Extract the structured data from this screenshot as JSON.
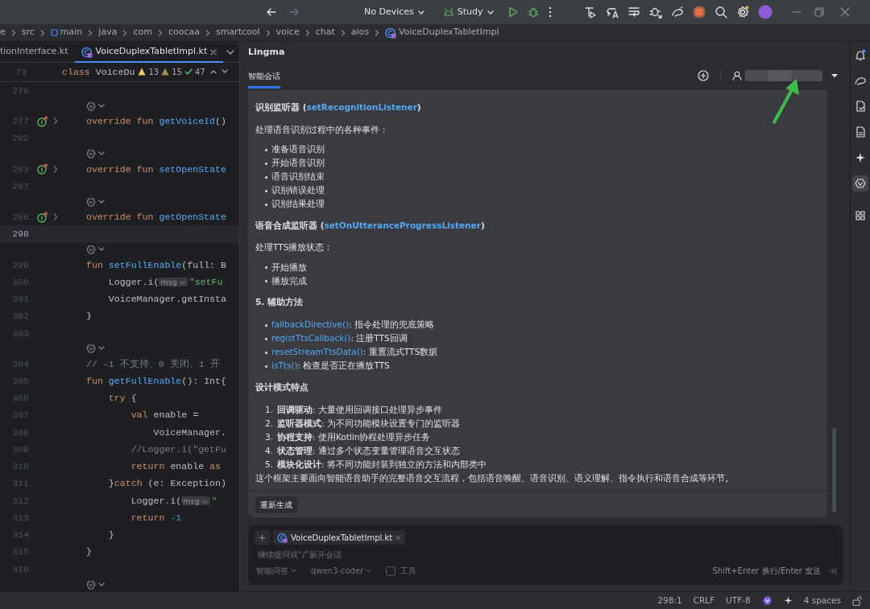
{
  "toolbar": {
    "device": "No Devices",
    "config": "Study"
  },
  "breadcrumb": [
    {
      "label": "e",
      "kind": "folder"
    },
    {
      "label": "src",
      "kind": "folder"
    },
    {
      "label": "main",
      "kind": "module"
    },
    {
      "label": "java",
      "kind": "folder"
    },
    {
      "label": "com",
      "kind": "folder"
    },
    {
      "label": "coocaa",
      "kind": "folder"
    },
    {
      "label": "smartcool",
      "kind": "folder"
    },
    {
      "label": "voice",
      "kind": "folder"
    },
    {
      "label": "chat",
      "kind": "folder"
    },
    {
      "label": "aios",
      "kind": "folder"
    },
    {
      "label": "VoiceDuplexTabletImpl",
      "kind": "class"
    }
  ],
  "editor_tabs": [
    {
      "label": "tionInterface.kt",
      "selected": false
    },
    {
      "label": "VoiceDuplexTabletImpl.kt",
      "selected": true
    }
  ],
  "sticky_line": {
    "number": "73",
    "tokens": [
      {
        "kind": "kw",
        "text": "class "
      },
      {
        "kind": "pl",
        "text": "VoiceDu"
      }
    ]
  },
  "inspections": [
    {
      "kind": "warning",
      "count": "13"
    },
    {
      "kind": "weak",
      "count": "15"
    },
    {
      "kind": "typo",
      "count": "47"
    }
  ],
  "code_lines": [
    {
      "kind": "code",
      "number": "276",
      "current": false,
      "implements": false
    },
    {
      "kind": "lens"
    },
    {
      "kind": "code",
      "number": "277",
      "current": false,
      "implements": true,
      "tokens": [
        {
          "kind": "kw",
          "text": "override fun "
        },
        {
          "kind": "fn",
          "text": "getVoiceId"
        },
        {
          "kind": "pl",
          "text": "()"
        }
      ]
    },
    {
      "kind": "code",
      "number": "282",
      "current": false,
      "implements": false
    },
    {
      "kind": "lens"
    },
    {
      "kind": "code",
      "number": "283",
      "current": false,
      "implements": true,
      "tokens": [
        {
          "kind": "kw",
          "text": "override fun "
        },
        {
          "kind": "fn",
          "text": "setOpenState"
        }
      ]
    },
    {
      "kind": "code",
      "number": "287",
      "current": false,
      "implements": false
    },
    {
      "kind": "lens"
    },
    {
      "kind": "code",
      "number": "288",
      "current": false,
      "implements": true,
      "tokens": [
        {
          "kind": "kw",
          "text": "override fun "
        },
        {
          "kind": "fn",
          "text": "getOpenState"
        }
      ]
    },
    {
      "kind": "code",
      "number": "298",
      "current": true,
      "implements": false
    },
    {
      "kind": "lens"
    },
    {
      "kind": "code",
      "number": "299",
      "current": false,
      "implements": false,
      "tokens": [
        {
          "kind": "kw",
          "text": "fun "
        },
        {
          "kind": "fn",
          "text": "setFullEnable"
        },
        {
          "kind": "pl",
          "text": "(full: B"
        }
      ]
    },
    {
      "kind": "code",
      "number": "300",
      "current": false,
      "implements": false,
      "tokens": [
        {
          "kind": "pl",
          "text": "    Logger.i("
        },
        {
          "kind": "hint",
          "text": "msg ="
        },
        {
          "kind": "str",
          "text": "\"setFu"
        }
      ]
    },
    {
      "kind": "code",
      "number": "301",
      "current": false,
      "implements": false,
      "tokens": [
        {
          "kind": "pl",
          "text": "    VoiceManager.getInsta"
        }
      ]
    },
    {
      "kind": "code",
      "number": "302",
      "current": false,
      "implements": false,
      "tokens": [
        {
          "kind": "pl",
          "text": "}"
        }
      ]
    },
    {
      "kind": "code",
      "number": "303",
      "current": false,
      "implements": false
    },
    {
      "kind": "lens"
    },
    {
      "kind": "code",
      "number": "304",
      "current": false,
      "implements": false,
      "tokens": [
        {
          "kind": "cm",
          "text": "// -1 不支持、0 关闭、1 开"
        }
      ]
    },
    {
      "kind": "code",
      "number": "305",
      "current": false,
      "implements": false,
      "tokens": [
        {
          "kind": "kw",
          "text": "fun "
        },
        {
          "kind": "fn",
          "text": "getFullEnable"
        },
        {
          "kind": "pl",
          "text": "(): Int{"
        }
      ]
    },
    {
      "kind": "code",
      "number": "306",
      "current": false,
      "implements": false,
      "tokens": [
        {
          "kind": "kw",
          "text": "    try "
        },
        {
          "kind": "pl",
          "text": "{"
        }
      ]
    },
    {
      "kind": "code",
      "number": "307",
      "current": false,
      "implements": false,
      "tokens": [
        {
          "kind": "kw",
          "text": "        val "
        },
        {
          "kind": "pl",
          "text": "enable ="
        }
      ]
    },
    {
      "kind": "code",
      "number": "308",
      "current": false,
      "implements": false,
      "tokens": [
        {
          "kind": "pl",
          "text": "            VoiceManager."
        }
      ]
    },
    {
      "kind": "code",
      "number": "309",
      "current": false,
      "implements": false,
      "tokens": [
        {
          "kind": "cm",
          "text": "        //Logger.i(\"getFu"
        }
      ]
    },
    {
      "kind": "code",
      "number": "310",
      "current": false,
      "implements": false,
      "tokens": [
        {
          "kind": "kw",
          "text": "        return "
        },
        {
          "kind": "pl",
          "text": "enable "
        },
        {
          "kind": "kw",
          "text": "as"
        }
      ]
    },
    {
      "kind": "code",
      "number": "311",
      "current": false,
      "implements": false,
      "tokens": [
        {
          "kind": "pl",
          "text": "    }"
        },
        {
          "kind": "kw",
          "text": "catch "
        },
        {
          "kind": "pl",
          "text": "(e: Exception)"
        }
      ]
    },
    {
      "kind": "code",
      "number": "312",
      "current": false,
      "implements": false,
      "tokens": [
        {
          "kind": "pl",
          "text": "        Logger.i("
        },
        {
          "kind": "hint",
          "text": "msg ="
        },
        {
          "kind": "str",
          "text": "\""
        }
      ]
    },
    {
      "kind": "code",
      "number": "313",
      "current": false,
      "implements": false,
      "tokens": [
        {
          "kind": "kw",
          "text": "        return "
        },
        {
          "kind": "num",
          "text": "-1"
        }
      ]
    },
    {
      "kind": "code",
      "number": "314",
      "current": false,
      "implements": false,
      "tokens": [
        {
          "kind": "pl",
          "text": "    }"
        }
      ]
    },
    {
      "kind": "code",
      "number": "315",
      "current": false,
      "implements": false,
      "tokens": [
        {
          "kind": "pl",
          "text": "}"
        }
      ]
    },
    {
      "kind": "code",
      "number": "316",
      "current": false,
      "implements": false
    },
    {
      "kind": "lens"
    }
  ],
  "chat": {
    "title": "Lingma",
    "tabs": [
      {
        "label": "智能会话",
        "selected": true
      }
    ],
    "blocks": [
      {
        "kind": "heading",
        "text": "识别监听器 (",
        "code": "setRecognitionListener",
        "tail": ")"
      },
      {
        "kind": "para",
        "text": "处理语音识别过程中的各种事件："
      },
      {
        "kind": "bullets",
        "items": [
          {
            "text": "准备语音识别"
          },
          {
            "text": "开始语音识别"
          },
          {
            "text": "语音识别结束"
          },
          {
            "text": "识别错误处理"
          },
          {
            "text": "识别结果处理"
          }
        ]
      },
      {
        "kind": "heading",
        "text": "语音合成监听器 (",
        "code": "setOnUtteranceProgressListener",
        "tail": ")"
      },
      {
        "kind": "para",
        "text": "处理TTS播放状态："
      },
      {
        "kind": "bullets",
        "items": [
          {
            "text": "开始播放"
          },
          {
            "text": "播放完成"
          }
        ]
      },
      {
        "kind": "heading",
        "text": "5. 辅助方法"
      },
      {
        "kind": "bullets",
        "items": [
          {
            "code": "fallbackDirective()",
            "text": ": 指令处理的兜底策略"
          },
          {
            "code": "registTtsCallback()",
            "text": ": 注册TTS回调"
          },
          {
            "code": "resetStreamTtsData()",
            "text": ": 重置流式TTS数据"
          },
          {
            "code": "isTts()",
            "text": ": 检查是否正在播放TTS"
          }
        ]
      },
      {
        "kind": "heading",
        "text": "设计模式特点"
      },
      {
        "kind": "numbered",
        "items": [
          {
            "number": "1.",
            "text": "**回调驱动**: 大量使用回调接口处理异步事件"
          },
          {
            "number": "2.",
            "text": "**监听器模式**: 为不同功能模块设置专门的监听器"
          },
          {
            "number": "3.",
            "text": "**协程支持**: 使用Kotlin协程处理异步任务"
          },
          {
            "number": "4.",
            "text": "**状态管理**: 通过多个状态变量管理语音交互状态"
          },
          {
            "number": "5.",
            "text": "**模块化设计**: 将不同功能封装到独立的方法和内部类中"
          }
        ]
      },
      {
        "kind": "para",
        "text": "这个框架主要面向智能语音助手的完整语音交互流程，包括语音唤醒、语音识别、语义理解、指令执行和语音合成等环节。"
      }
    ],
    "regenerate": "重新生成",
    "input": {
      "attachment": "VoiceDuplexTabletImpl.kt",
      "placeholder": "继续提问或“/”新开会话",
      "mode": "智能问答",
      "model": "qwen3-coder",
      "tools": {
        "label": "工具",
        "checked": false
      },
      "hint": "Shift+Enter 换行/Enter 发送"
    }
  },
  "right_toolbar": [
    {
      "kind": "bell",
      "selected": false
    },
    {
      "kind": "lizard",
      "selected": false
    },
    {
      "kind": "doc",
      "selected": false
    },
    {
      "kind": "doc2",
      "selected": false
    },
    {
      "kind": "sparkle",
      "selected": false
    },
    {
      "kind": "lingma",
      "selected": true
    },
    {
      "kind": "grid",
      "selected": false
    }
  ],
  "status_bar": {
    "position": "298:1",
    "line_separator": "CRLF",
    "encoding": "UTF-8",
    "indent": "4 spaces"
  }
}
